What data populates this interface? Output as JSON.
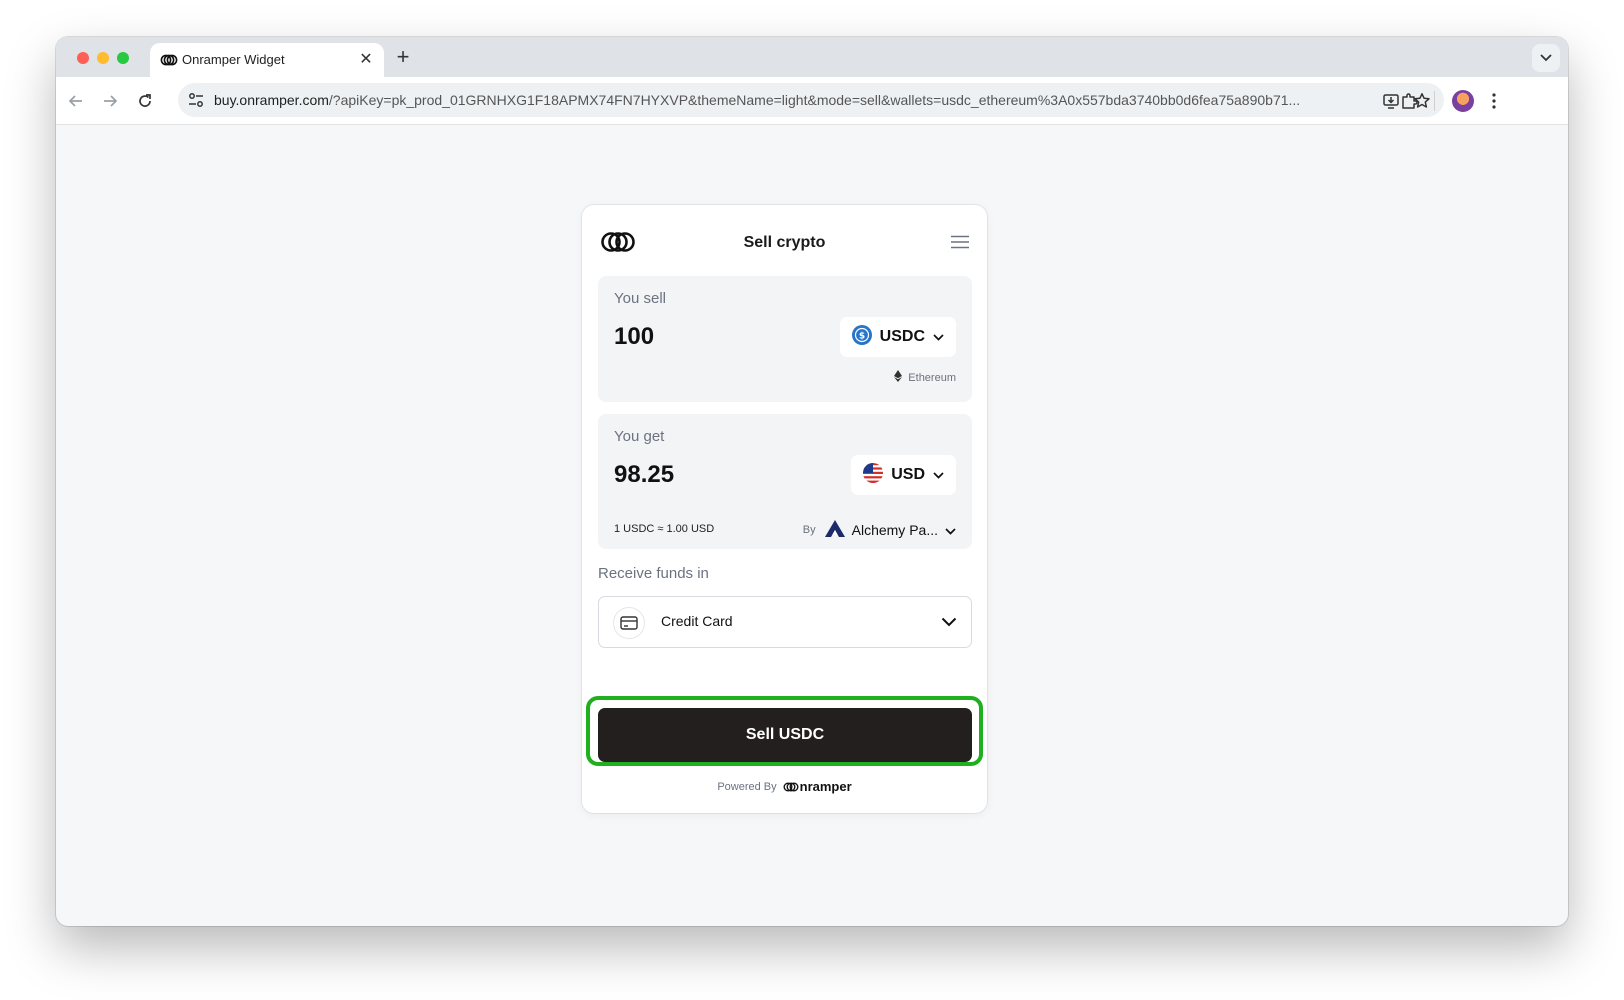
{
  "browser": {
    "tab_title": "Onramper Widget",
    "close_glyph": "✕",
    "new_tab_glyph": "+",
    "url_host": "buy.onramper.com",
    "url_rest": "/?apiKey=pk_prod_01GRNHXG1F18APMX74FN7HYXVP&themeName=light&mode=sell&wallets=usdc_ethereum%3A0x557bda3740bb0d6fea75a890b71..."
  },
  "widget": {
    "title": "Sell crypto",
    "sell": {
      "label": "You sell",
      "amount": "100",
      "token": "USDC",
      "network": "Ethereum"
    },
    "get": {
      "label": "You get",
      "amount": "98.25",
      "currency": "USD",
      "rate": "1 USDC ≈ 1.00 USD",
      "by_label": "By",
      "provider": "Alchemy Pa..."
    },
    "receive": {
      "label": "Receive funds in",
      "method": "Credit Card"
    },
    "cta": "Sell USDC",
    "powered_by": "Powered By",
    "brand": "nramper"
  },
  "colors": {
    "cta_bg": "#231f1e",
    "highlight": "#1faf1f",
    "usdc": "#2775ca"
  }
}
